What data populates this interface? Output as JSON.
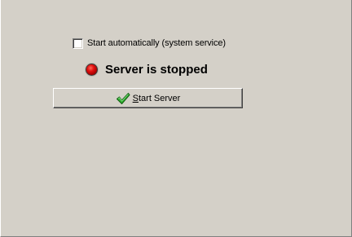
{
  "options": {
    "autostart_checked": false,
    "autostart_label": "Start automatically (system service)"
  },
  "status": {
    "text": "Server is stopped",
    "indicator": "red-led-icon",
    "color": "#e01010"
  },
  "actions": {
    "start_label_first": "S",
    "start_label_rest": "tart Server",
    "start_icon": "green-checkmark-icon",
    "icon_color": "#1a9a1a"
  }
}
